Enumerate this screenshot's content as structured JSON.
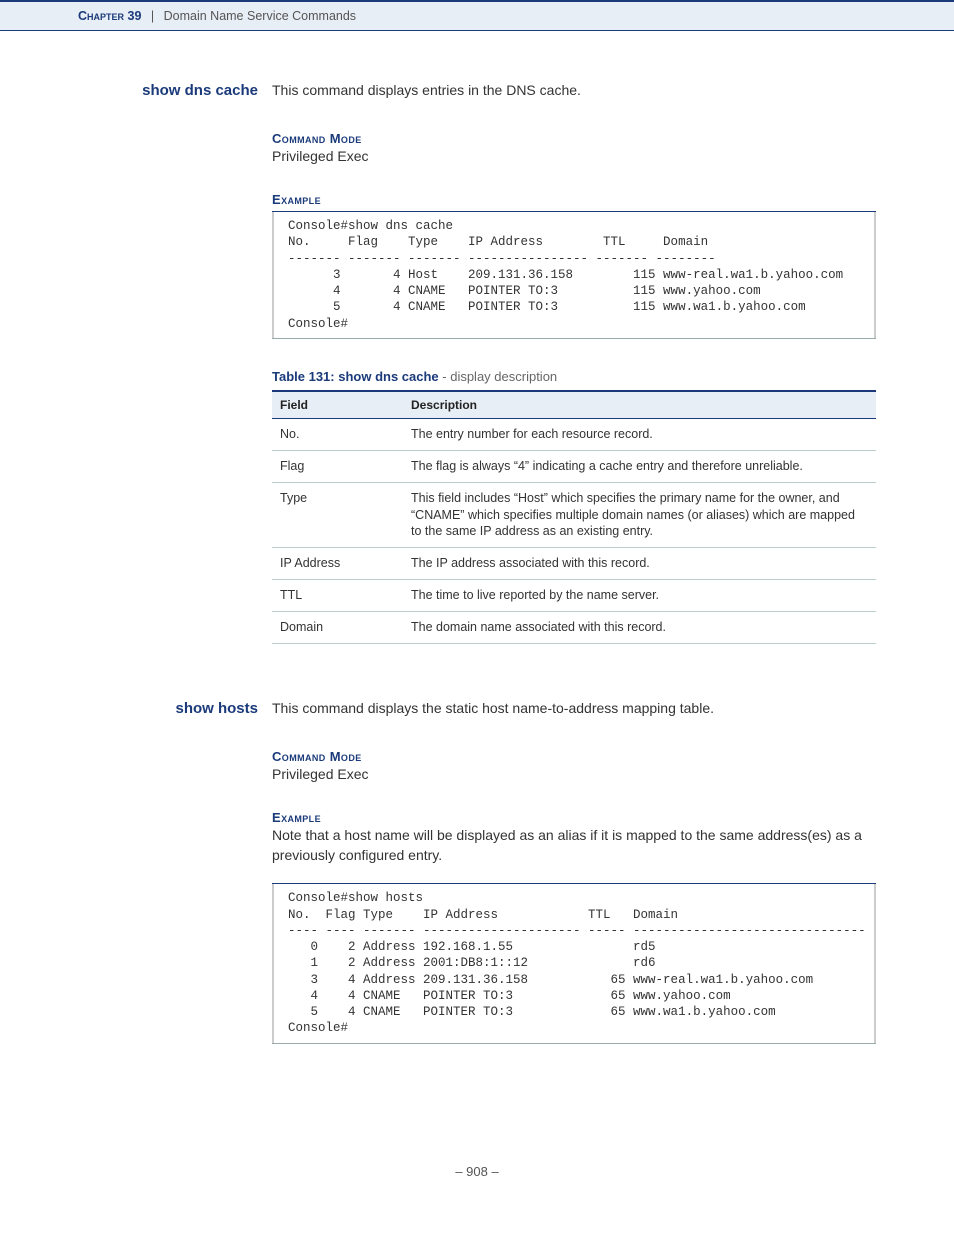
{
  "header": {
    "chapter_label": "Chapter 39",
    "separator": "|",
    "chapter_name": "Domain Name Service Commands"
  },
  "sections": [
    {
      "side_heading": "show dns cache",
      "intro_text": "This command displays entries in the DNS cache.",
      "command_mode_label": "Command Mode",
      "command_mode_value": "Privileged Exec",
      "example_label": "Example",
      "example_note": "",
      "example_output": "Console#show dns cache\nNo.     Flag    Type    IP Address        TTL     Domain\n------- ------- ------- ---------------- ------- --------\n      3       4 Host    209.131.36.158        115 www-real.wa1.b.yahoo.com\n      4       4 CNAME   POINTER TO:3          115 www.yahoo.com\n      5       4 CNAME   POINTER TO:3          115 www.wa1.b.yahoo.com\nConsole#",
      "table_caption_strong": "Table 131: show dns cache",
      "table_caption_light": " - display description",
      "table_head_field": "Field",
      "table_head_desc": "Description",
      "table_rows": [
        {
          "field": "No.",
          "desc": "The entry number for each resource record."
        },
        {
          "field": "Flag",
          "desc": "The flag is always “4” indicating a cache entry and therefore unreliable."
        },
        {
          "field": "Type",
          "desc": "This field includes “Host” which specifies the primary name for the owner, and “CNAME” which specifies multiple domain names (or aliases) which are mapped to the same IP address as an existing entry."
        },
        {
          "field": "IP Address",
          "desc": "The IP address associated with this record."
        },
        {
          "field": "TTL",
          "desc": "The time to live reported by the name server."
        },
        {
          "field": "Domain",
          "desc": "The domain name associated with this record."
        }
      ]
    },
    {
      "side_heading": "show hosts",
      "intro_text": "This command displays the static host name-to-address mapping table.",
      "command_mode_label": "Command Mode",
      "command_mode_value": "Privileged Exec",
      "example_label": "Example",
      "example_note": "Note that a host name will be displayed as an alias if it is mapped to the same address(es) as a previously configured entry.",
      "example_output": "Console#show hosts\nNo.  Flag Type    IP Address            TTL   Domain\n---- ---- ------- --------------------- ----- -------------------------------\n   0    2 Address 192.168.1.55                rd5\n   1    2 Address 2001:DB8:1::12              rd6\n   3    4 Address 209.131.36.158           65 www-real.wa1.b.yahoo.com\n   4    4 CNAME   POINTER TO:3             65 www.yahoo.com\n   5    4 CNAME   POINTER TO:3             65 www.wa1.b.yahoo.com\nConsole#"
    }
  ],
  "page_number": "–  908  –"
}
